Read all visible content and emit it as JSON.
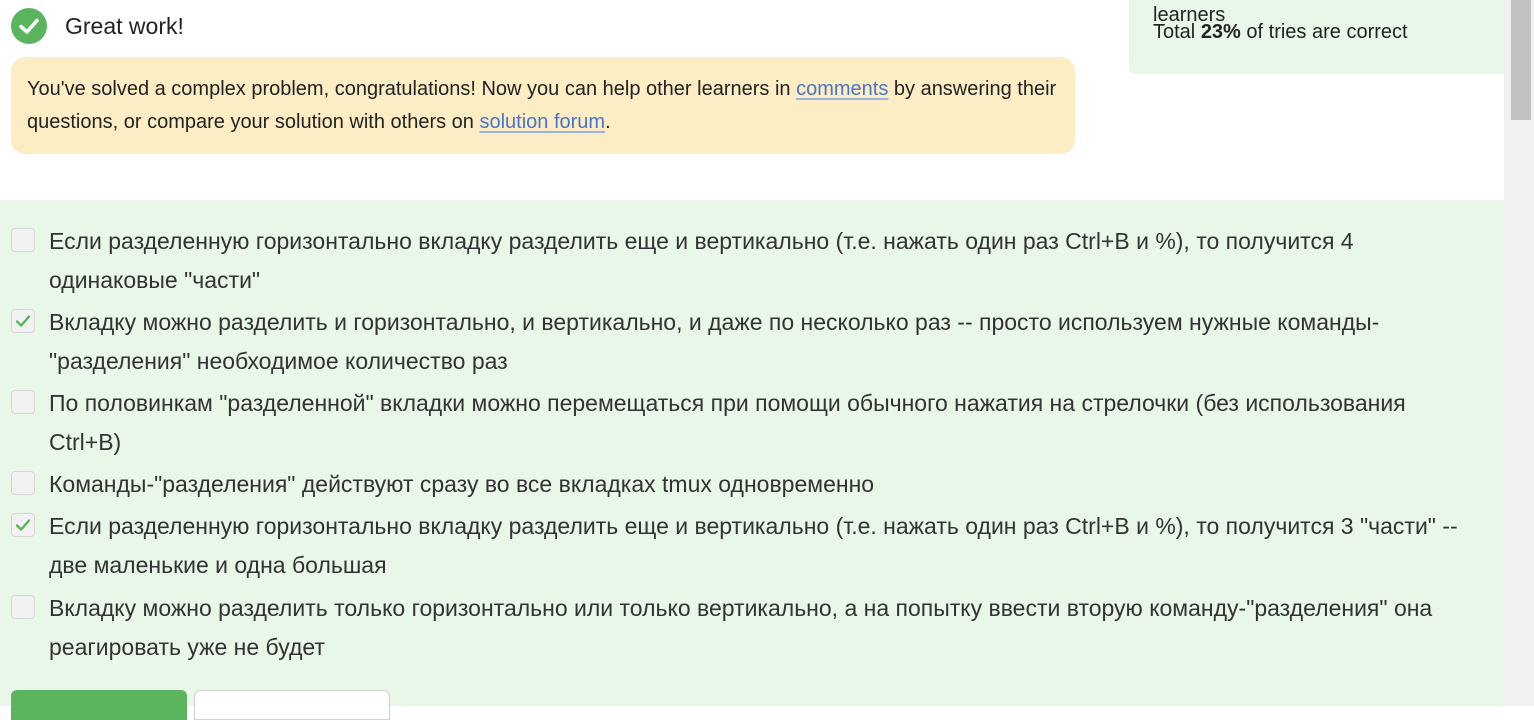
{
  "success": {
    "title": "Great work!",
    "icon": "check-circle-icon",
    "color": "#5ab55e"
  },
  "stats": {
    "line1": "learners",
    "prefix": "Total ",
    "percent": "23%",
    "suffix": " of tries are correct"
  },
  "congrats": {
    "text1": "You've solved a complex problem, congratulations! Now you can help other learners in ",
    "link_comments": "comments",
    "text2": " by answering their questions, or compare your solution with others on ",
    "link_forum": "solution forum",
    "text3": "."
  },
  "options": [
    {
      "text": "Если разделенную горизонтально вкладку разделить еще и вертикально (т.е. нажать один раз Ctrl+B и %), то получится 4 одинаковые \"части\"",
      "checked": false
    },
    {
      "text": "Вкладку можно разделить и горизонтально, и вертикально, и даже по несколько раз -- просто используем нужные команды-\"разделения\" необходимое количество раз",
      "checked": true
    },
    {
      "text": "По половинкам \"разделенной\" вкладки можно перемещаться при помощи обычного нажатия на стрелочки (без использования Ctrl+B)",
      "checked": false
    },
    {
      "text": "Команды-\"разделения\" действуют сразу во все вкладках tmux одновременно",
      "checked": false
    },
    {
      "text": "Если разделенную горизонтально вкладку разделить еще и вертикально (т.е. нажать один раз Ctrl+B и %), то получится 3 \"части\" -- две маленькие и одна большая",
      "checked": true
    },
    {
      "text": "Вкладку можно разделить только горизонтально или только вертикально, а на попытку ввести вторую команду-\"разделения\" она реагировать уже не будет",
      "checked": false
    }
  ],
  "colors": {
    "quiz_bg": "#e8f7e8",
    "notice_bg": "#fdedc4",
    "link": "#4a74c7",
    "accent": "#5ab55e"
  }
}
